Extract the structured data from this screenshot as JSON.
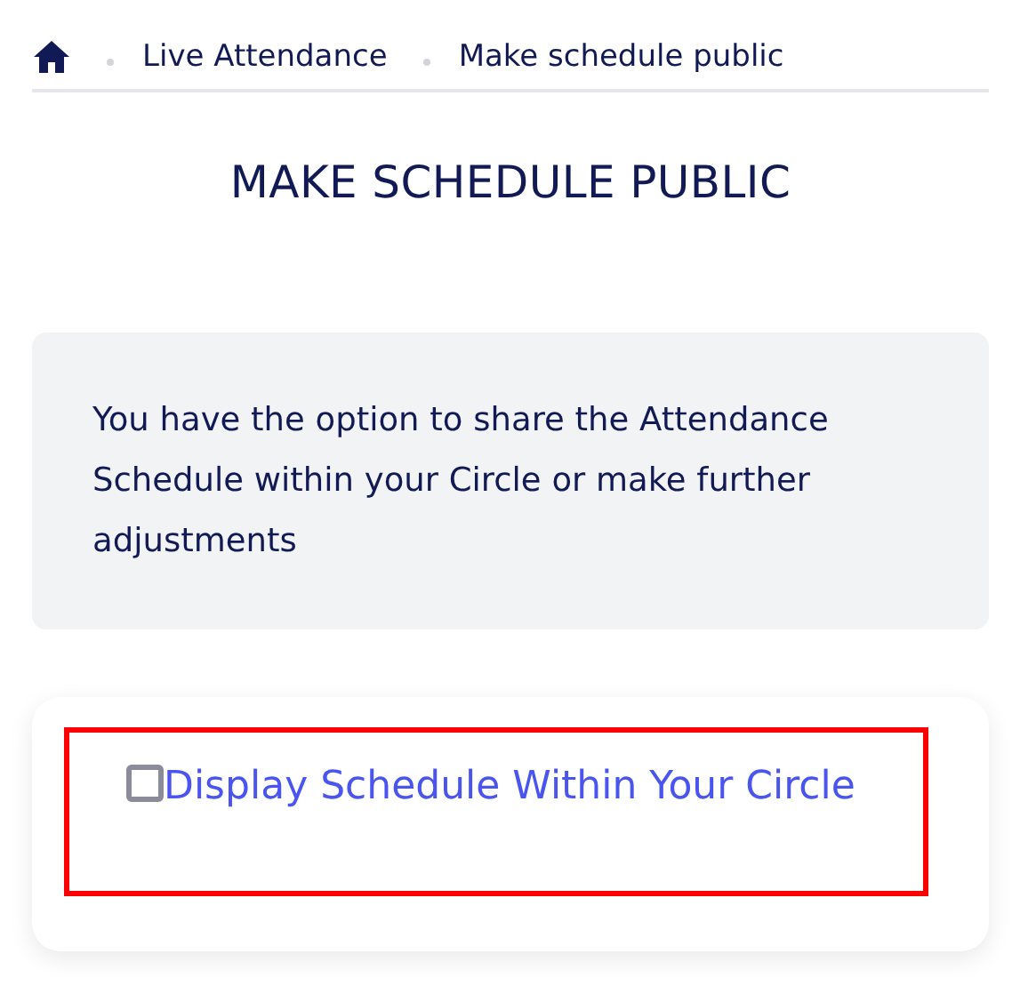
{
  "breadcrumb": {
    "items": [
      {
        "label": "Live Attendance"
      },
      {
        "label": "Make schedule public"
      }
    ]
  },
  "title": "MAKE SCHEDULE PUBLIC",
  "info": "You have the option to share the Attendance Schedule within your Circle or make further adjustments",
  "option": {
    "label": "Display Schedule Within Your Circle",
    "checked": false,
    "highlighted": true
  }
}
